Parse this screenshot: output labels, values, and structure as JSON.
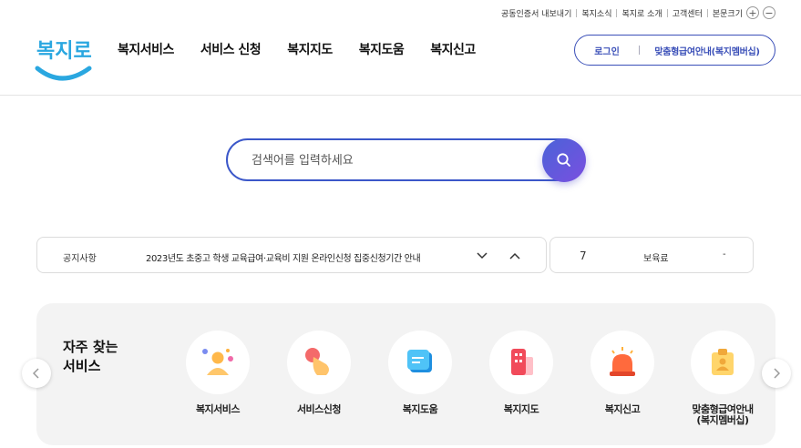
{
  "utility": {
    "items": [
      "공동인증서 내보내기",
      "복지소식",
      "복지로 소개",
      "고객센터"
    ],
    "font_size_label": "본문크기",
    "zoom_in": "+",
    "zoom_out": "−"
  },
  "header": {
    "logo_text": "복지로",
    "brand_color": "#2aa7e0",
    "nav": [
      "복지서비스",
      "서비스 신청",
      "복지지도",
      "복지도움",
      "복지신고"
    ],
    "login_label": "로그인",
    "custom_label": "맞춤형급여안내(복지멤버십)",
    "accent": "#3a4fb8"
  },
  "search": {
    "placeholder": "검색어를 입력하세요",
    "icon": "search-icon"
  },
  "notice": {
    "tag": "공지사항",
    "text": "2023년도 초중고 학생 교육급여·교육비 지원 온라인신청 집중신청기간 안내",
    "prev_icon": "chevron-down-icon",
    "next_icon": "chevron-up-icon"
  },
  "stat": {
    "count": "7",
    "label": "보육료",
    "value": "-"
  },
  "frequent": {
    "title_line1": "자주 찾는",
    "title_line2": "서비스",
    "items": [
      {
        "label": "복지서비스",
        "icon": "person-icon"
      },
      {
        "label": "서비스신청",
        "icon": "hand-pointer-icon"
      },
      {
        "label": "복지도움",
        "icon": "chat-document-icon"
      },
      {
        "label": "복지지도",
        "icon": "building-map-icon"
      },
      {
        "label": "복지신고",
        "icon": "siren-icon"
      },
      {
        "label": "맞춤형급여안내\n(복지멤버십)",
        "icon": "id-badge-icon"
      }
    ],
    "prev_icon": "chevron-left-icon",
    "next_icon": "chevron-right-icon"
  }
}
